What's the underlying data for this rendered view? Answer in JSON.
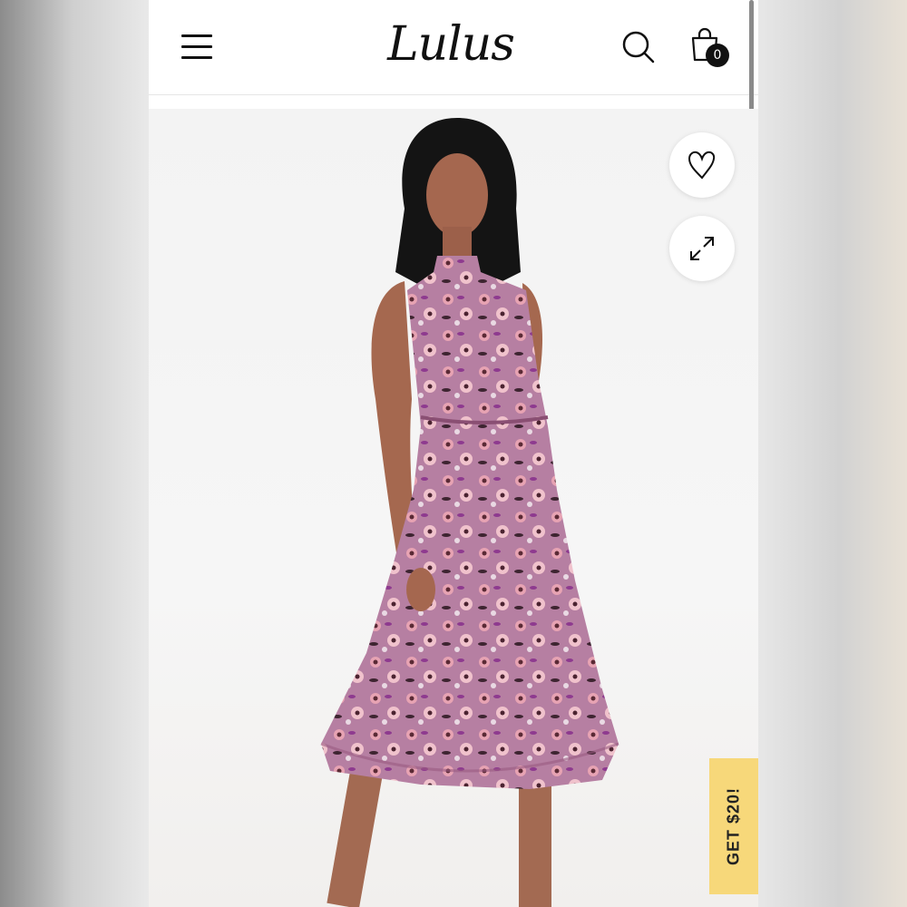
{
  "header": {
    "logo_text": "Lulus",
    "cart_count": "0"
  },
  "promo": {
    "label": "GET $20!",
    "color": "#f7d87a"
  },
  "icons": [
    "menu-icon",
    "search-icon",
    "shopping-bag-icon",
    "heart-icon",
    "expand-icon"
  ],
  "product": {
    "dress_color": "#b67fa2"
  }
}
